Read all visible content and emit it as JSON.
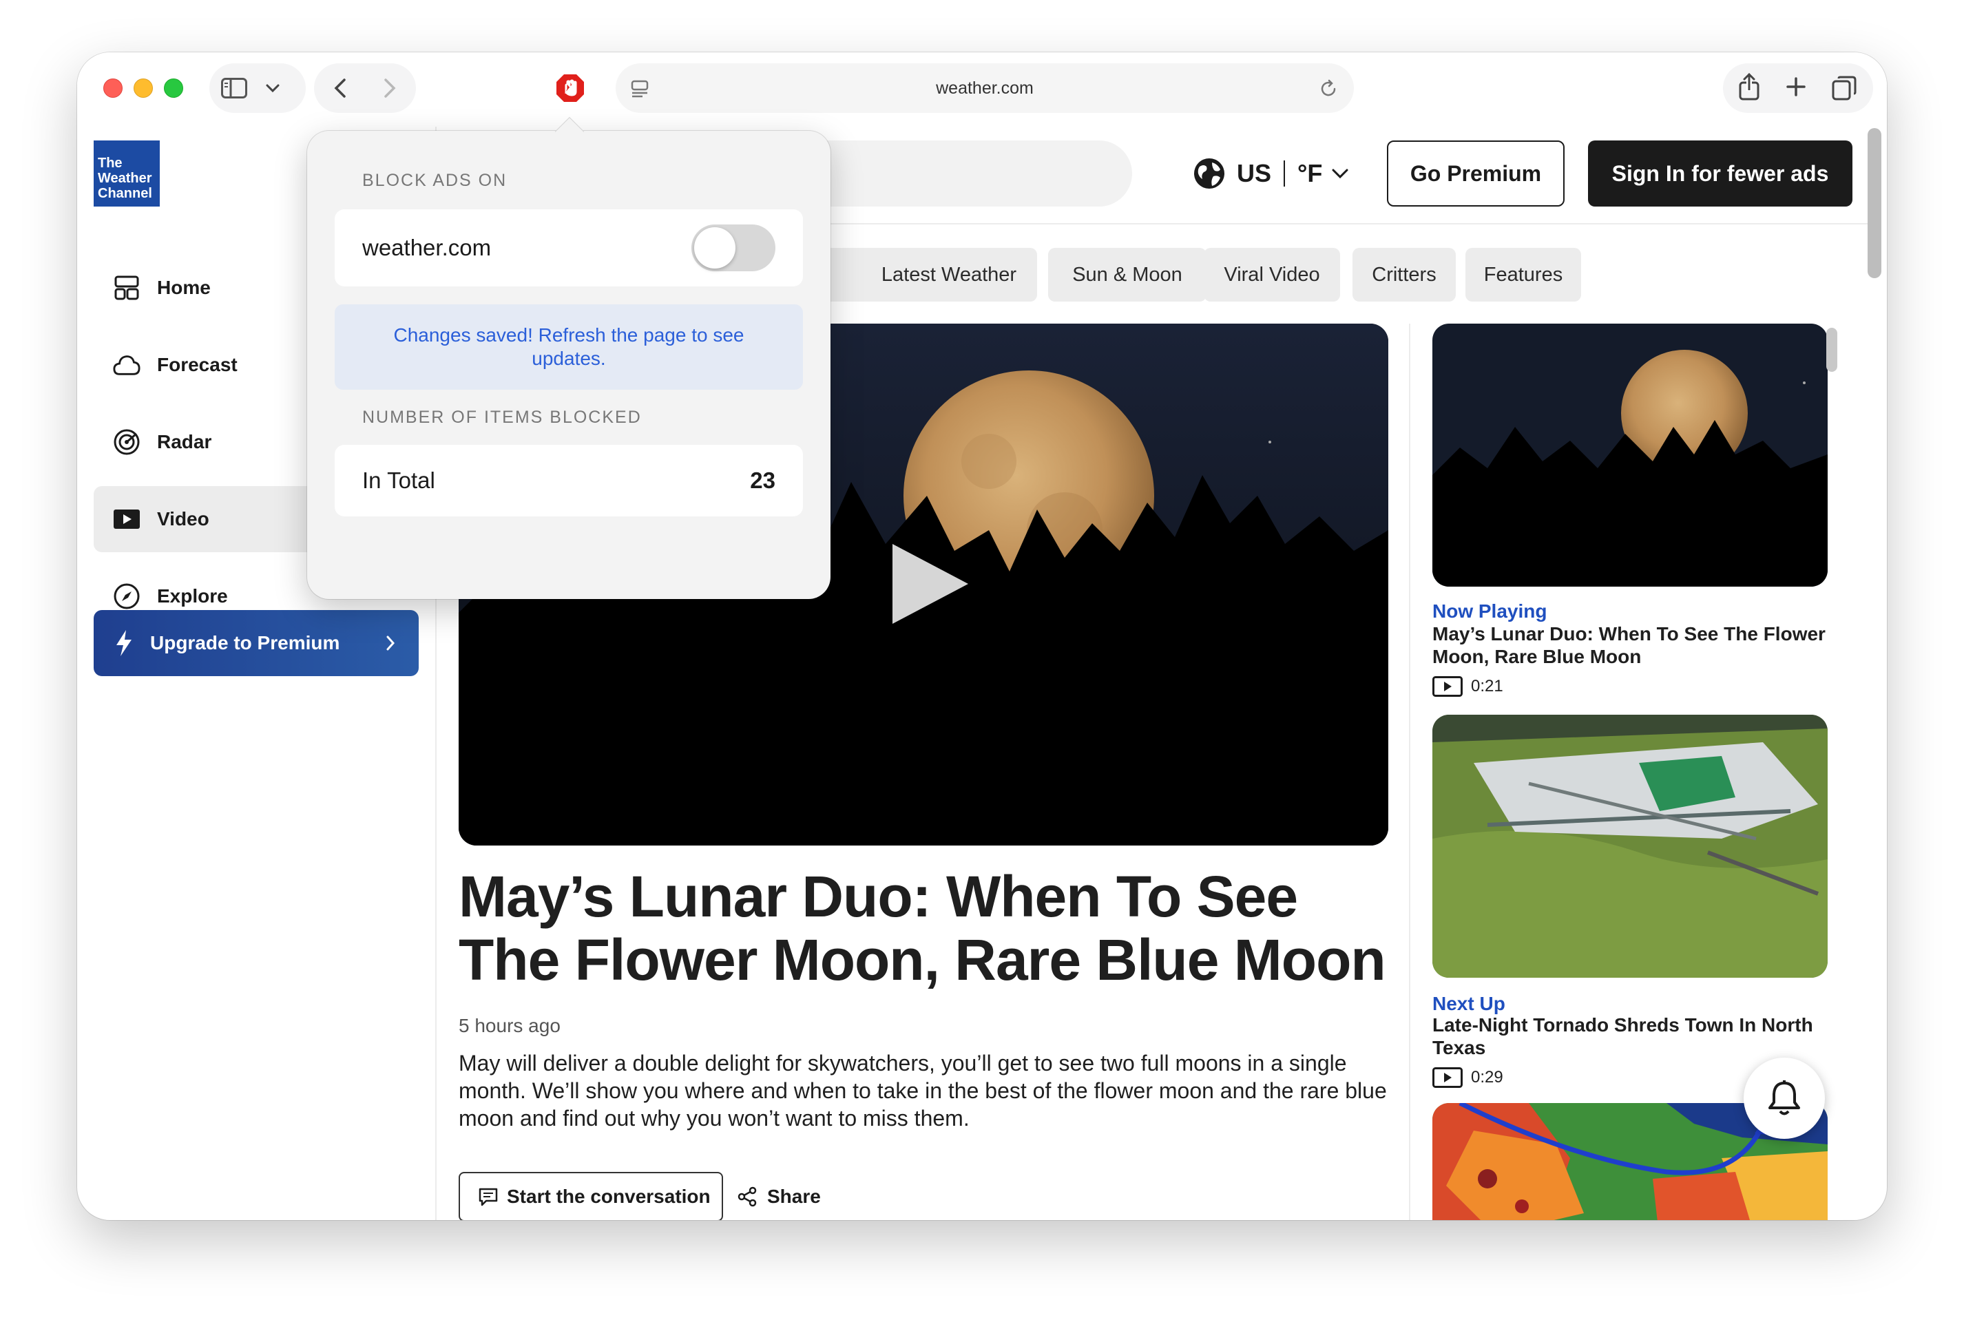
{
  "browser": {
    "url": "weather.com"
  },
  "site": {
    "logo_lines": [
      "The",
      "Weather",
      "Channel"
    ],
    "nav": [
      {
        "label": "Home",
        "icon": "home-icon"
      },
      {
        "label": "Forecast",
        "icon": "cloud-icon"
      },
      {
        "label": "Radar",
        "icon": "radar-icon"
      },
      {
        "label": "Video",
        "icon": "video-icon",
        "active": true
      },
      {
        "label": "Explore",
        "icon": "compass-icon"
      }
    ],
    "upgrade_label": "Upgrade to Premium",
    "locale": {
      "country": "US",
      "unit": "°F"
    },
    "go_premium": "Go Premium",
    "sign_in": "Sign In for fewer ads",
    "chips": [
      "Latest Weather",
      "Sun & Moon",
      "Viral Video",
      "Critters",
      "Features"
    ]
  },
  "article": {
    "headline": "May’s Lunar Duo: When To See The Flower Moon, Rare Blue Moon",
    "timestamp": "5 hours ago",
    "summary": "May will deliver a double delight for skywatchers, you’ll get to see two full moons in a single month. We’ll show you where and when to take in the best of the flower moon and the rare blue moon and find out why you won’t want to miss them.",
    "conversation_label": "Start the conversation",
    "share_label": "Share"
  },
  "rail": [
    {
      "kicker": "Now Playing",
      "title": "May’s Lunar Duo: When To See The Flower Moon, Rare Blue Moon",
      "duration": "0:21"
    },
    {
      "kicker": "Next Up",
      "title": "Late-Night Tornado Shreds Town In North Texas",
      "duration": "0:29"
    }
  ],
  "popover": {
    "section_block": "BLOCK ADS ON",
    "site": "weather.com",
    "toggle_on": false,
    "notice": "Changes saved! Refresh the page to see updates.",
    "section_count": "NUMBER OF ITEMS BLOCKED",
    "total_label": "In Total",
    "total_value": "23"
  },
  "colors": {
    "accent_blue": "#2b5fd9",
    "logo_blue": "#1c4ba3",
    "kicker_blue": "#1f4fbf",
    "adblock_red": "#e0201b"
  }
}
